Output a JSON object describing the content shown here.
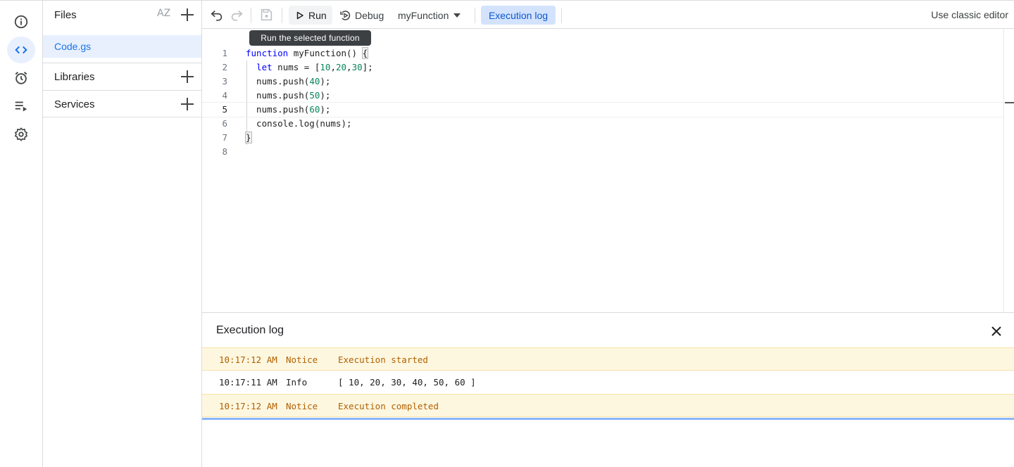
{
  "rail": {
    "items": [
      {
        "name": "overview",
        "icon": "info-icon"
      },
      {
        "name": "editor",
        "icon": "code-icon",
        "active": true
      },
      {
        "name": "triggers",
        "icon": "alarm-icon"
      },
      {
        "name": "executions",
        "icon": "executions-icon"
      },
      {
        "name": "settings",
        "icon": "gear-icon"
      }
    ]
  },
  "files": {
    "title": "Files",
    "sort_label": "AZ",
    "items": [
      {
        "label": "Code.gs",
        "selected": true
      }
    ],
    "libraries_label": "Libraries",
    "services_label": "Services"
  },
  "toolbar": {
    "run_label": "Run",
    "debug_label": "Debug",
    "function_select": "myFunction",
    "execution_log_label": "Execution log",
    "classic_editor_label": "Use classic editor"
  },
  "tooltip": {
    "text": "Run the selected function"
  },
  "editor": {
    "current_line": 5,
    "lines": [
      {
        "n": "1",
        "code": "function myFunction() {"
      },
      {
        "n": "2",
        "code": "  let nums = [10,20,30];"
      },
      {
        "n": "3",
        "code": "  nums.push(40);"
      },
      {
        "n": "4",
        "code": "  nums.push(50);"
      },
      {
        "n": "5",
        "code": "  nums.push(60);"
      },
      {
        "n": "6",
        "code": "  console.log(nums);"
      },
      {
        "n": "7",
        "code": "}"
      },
      {
        "n": "8",
        "code": ""
      }
    ]
  },
  "log": {
    "title": "Execution log",
    "rows": [
      {
        "time": "10:17:12 AM",
        "level": "Notice",
        "message": "Execution started"
      },
      {
        "time": "10:17:11 AM",
        "level": "Info",
        "message": "[ 10, 20, 30, 40, 50, 60 ]"
      },
      {
        "time": "10:17:12 AM",
        "level": "Notice",
        "message": "Execution completed"
      }
    ]
  },
  "colors": {
    "accent": "#1a73e8",
    "active_bg": "#e8f0fe",
    "notice_bg": "#fef7e0",
    "notice_text": "#b06000"
  }
}
